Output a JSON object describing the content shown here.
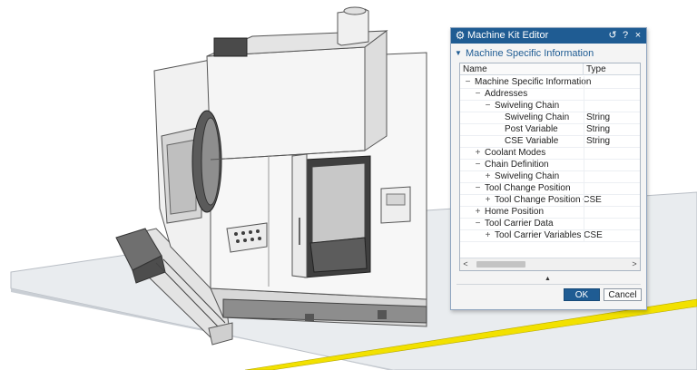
{
  "dialog": {
    "title": "Machine Kit Editor",
    "title_icon": "gear-icon",
    "controls": {
      "reset": "↺",
      "help": "?",
      "close": "×"
    },
    "section_label": "Machine Specific Information",
    "columns": {
      "name": "Name",
      "type": "Type"
    },
    "tree": [
      {
        "label": "Machine Specific Information",
        "type": "",
        "level": 0,
        "toggle": "−"
      },
      {
        "label": "Addresses",
        "type": "",
        "level": 1,
        "toggle": "−"
      },
      {
        "label": "Swiveling Chain",
        "type": "",
        "level": 2,
        "toggle": "−"
      },
      {
        "label": "Swiveling Chain",
        "type": "String",
        "level": 3,
        "toggle": ""
      },
      {
        "label": "Post Variable",
        "type": "String",
        "level": 3,
        "toggle": ""
      },
      {
        "label": "CSE Variable",
        "type": "String",
        "level": 3,
        "toggle": ""
      },
      {
        "label": "Coolant Modes",
        "type": "",
        "level": 1,
        "toggle": "+"
      },
      {
        "label": "Chain Definition",
        "type": "",
        "level": 1,
        "toggle": "−"
      },
      {
        "label": "Swiveling Chain",
        "type": "",
        "level": 2,
        "toggle": "+"
      },
      {
        "label": "Tool Change Position",
        "type": "",
        "level": 1,
        "toggle": "−"
      },
      {
        "label": "Tool Change Position CSE",
        "type": "",
        "level": 2,
        "toggle": "+"
      },
      {
        "label": "Home Position",
        "type": "",
        "level": 1,
        "toggle": "+"
      },
      {
        "label": "Tool Carrier Data",
        "type": "",
        "level": 1,
        "toggle": "−"
      },
      {
        "label": "Tool Carrier Variables CSE",
        "type": "",
        "level": 2,
        "toggle": "+"
      }
    ],
    "scrollbar": {
      "left_arrow": "<",
      "right_arrow": ">"
    },
    "splitter_grip": "▲",
    "ok_label": "OK",
    "cancel_label": "Cancel",
    "accent_color": "#1f5c93"
  },
  "scene": {
    "floor_color": "#e9ecef",
    "stripe_color": "#f2e100",
    "machine_color": "#f3f3f3"
  }
}
